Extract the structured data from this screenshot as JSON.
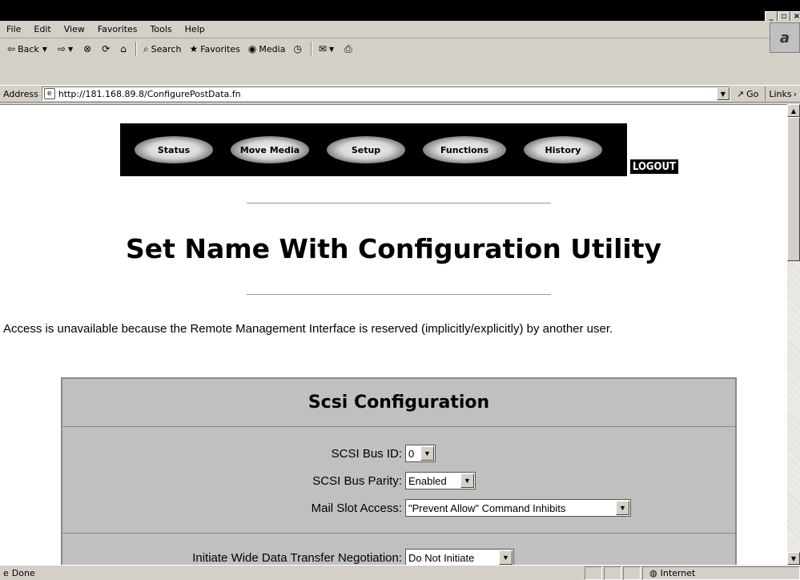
{
  "window": {
    "controls": [
      "_",
      "▫",
      "×"
    ],
    "brand_mark": "a"
  },
  "menu": [
    "File",
    "Edit",
    "View",
    "Favorites",
    "Tools",
    "Help"
  ],
  "toolbar": {
    "back": "Back",
    "search": "Search",
    "favorites": "Favorites",
    "media": "Media"
  },
  "address": {
    "label": "Address",
    "url": "http://181.168.89.8/ConfigurePostData.fn",
    "go": "Go",
    "links": "Links"
  },
  "nav": {
    "items": [
      "Status",
      "Move Media",
      "Setup",
      "Functions",
      "History"
    ],
    "logout": "LOGOUT"
  },
  "page": {
    "title": "Set Name With Configuration Utility",
    "message": "Access is unavailable because the Remote Management Interface is reserved (implicitly/explicitly) by another user."
  },
  "panel": {
    "heading": "Scsi Configuration",
    "rows": [
      {
        "label": "SCSI Bus ID:",
        "value": "0"
      },
      {
        "label": "SCSI Bus Parity:",
        "value": "Enabled"
      },
      {
        "label": "Mail Slot Access:",
        "value": "\"Prevent Allow\" Command Inhibits"
      },
      {
        "label": "Initiate Wide Data Transfer Negotiation:",
        "value": "Do Not Initiate"
      }
    ]
  },
  "status": {
    "text": "Done",
    "zone": "Internet"
  }
}
